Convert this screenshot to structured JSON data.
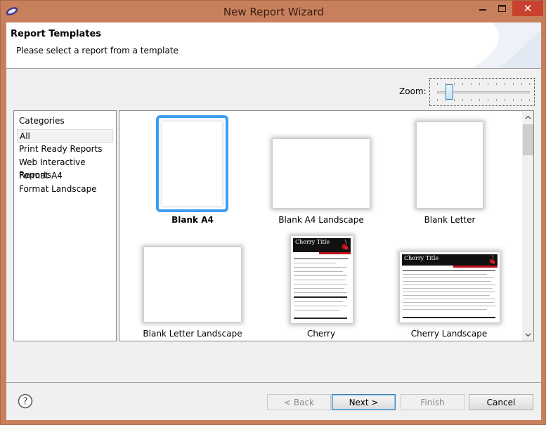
{
  "window": {
    "title": "New Report Wizard",
    "close_glyph": "✕",
    "icons": {
      "app": "eclipse-icon",
      "minimize": "minimize-icon",
      "maximize": "maximize-icon",
      "close": "close-icon"
    }
  },
  "header": {
    "title": "Report Templates",
    "subtitle": "Please select a report from a template"
  },
  "zoom": {
    "label": "Zoom:",
    "level": 0.1
  },
  "categories": {
    "title": "Categories",
    "selected_index": 0,
    "items": [
      {
        "label": "All"
      },
      {
        "label": "Print Ready Reports"
      },
      {
        "label": "Web Interactive Reports"
      },
      {
        "label": "Format A4"
      },
      {
        "label": "Format Landscape"
      }
    ]
  },
  "templates": {
    "selected": "Blank A4",
    "items": [
      {
        "label": "Blank A4"
      },
      {
        "label": "Blank A4 Landscape"
      },
      {
        "label": "Blank Letter"
      },
      {
        "label": "Blank Letter Landscape"
      },
      {
        "label": "Cherry",
        "thumb_title": "Cherry Title"
      },
      {
        "label": "Cherry Landscape",
        "thumb_title": "Cherry Title"
      }
    ]
  },
  "buttons": {
    "back": "< Back",
    "next": "Next >",
    "finish": "Finish",
    "cancel": "Cancel"
  },
  "colors": {
    "selection_ring": "#3d9ef0",
    "cherry_red": "#c0121a",
    "close_button": "#c8422f",
    "window_frame": "#c8805c"
  }
}
